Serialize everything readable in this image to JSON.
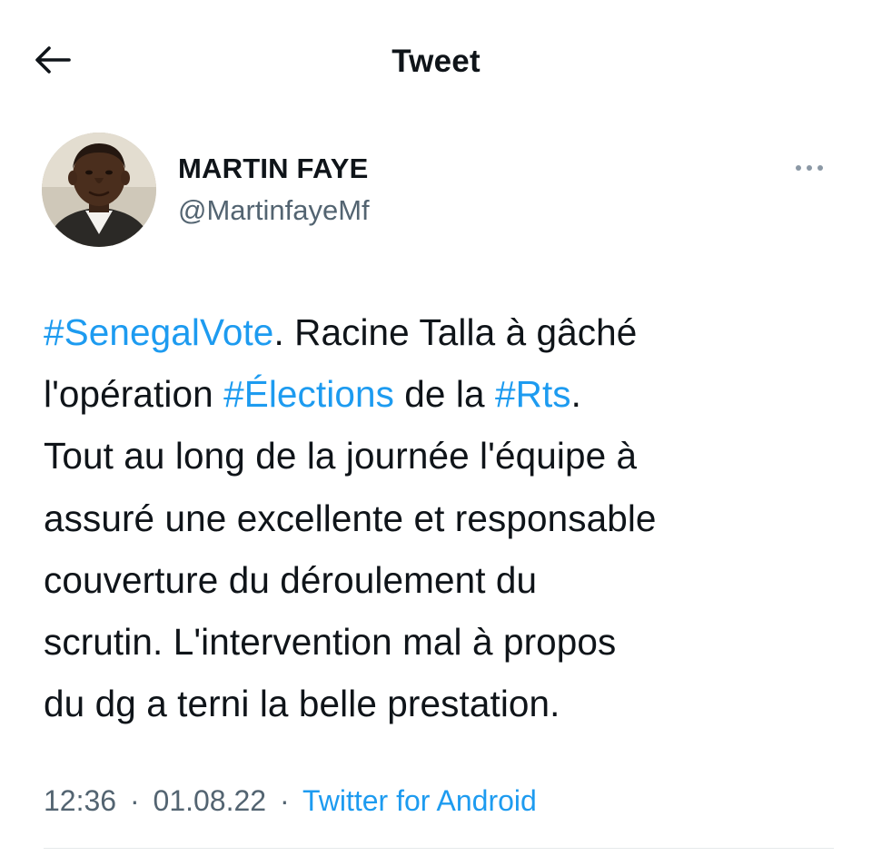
{
  "header": {
    "title": "Tweet",
    "back_icon": "arrow-left-icon"
  },
  "author": {
    "display_name": "MARTIN FAYE",
    "handle": "@MartinfayeMf",
    "more_icon": "more-horizontal-icon"
  },
  "tweet": {
    "lines": [
      [
        {
          "text": "#SenegalVote",
          "type": "hashtag"
        },
        {
          "text": ". Racine Talla à gâché",
          "type": "text"
        }
      ],
      [
        {
          "text": "l'opération ",
          "type": "text"
        },
        {
          "text": "#Élections",
          "type": "hashtag"
        },
        {
          "text": " de la ",
          "type": "text"
        },
        {
          "text": "#Rts",
          "type": "hashtag"
        },
        {
          "text": ".",
          "type": "text"
        }
      ],
      [
        {
          "text": "Tout au long de la journée l'équipe à",
          "type": "text"
        }
      ],
      [
        {
          "text": "assuré une excellente et responsable",
          "type": "text"
        }
      ],
      [
        {
          "text": "couverture du déroulement du",
          "type": "text"
        }
      ],
      [
        {
          "text": "scrutin. L'intervention mal à propos",
          "type": "text"
        }
      ],
      [
        {
          "text": "du dg a terni la belle prestation.",
          "type": "text"
        }
      ]
    ]
  },
  "meta": {
    "time": "12:36",
    "separator": "·",
    "date": "01.08.22",
    "source": "Twitter for Android"
  },
  "colors": {
    "link": "#1d9bf0",
    "secondary_text": "#536471",
    "primary_text": "#0f1419"
  }
}
